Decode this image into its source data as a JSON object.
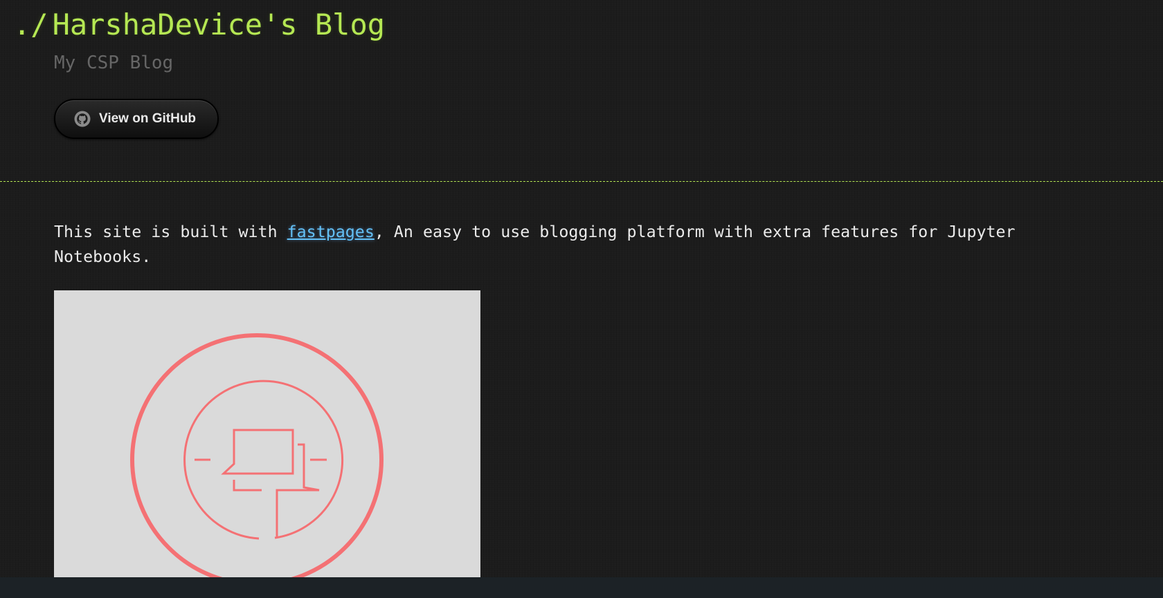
{
  "header": {
    "prompt": "./",
    "title": "HarshaDevice's Blog",
    "subtitle": "My CSP Blog",
    "github_button": {
      "label": "View on GitHub",
      "icon": "github-icon"
    }
  },
  "main": {
    "intro_before_link": "This site is built with ",
    "intro_link_text": "fastpages",
    "intro_after_link": ", An easy to use blogging platform with extra features for Jupyter Notebooks.",
    "logo_image": {
      "icon": "fastpages-logo",
      "background_color": "#dadada",
      "stroke_color": "#f47174"
    }
  },
  "theme": {
    "accent": "#b5e853",
    "link": "#63c0f5",
    "text": "#eaeaea",
    "muted": "#666666",
    "background": "#1c1c1c"
  }
}
